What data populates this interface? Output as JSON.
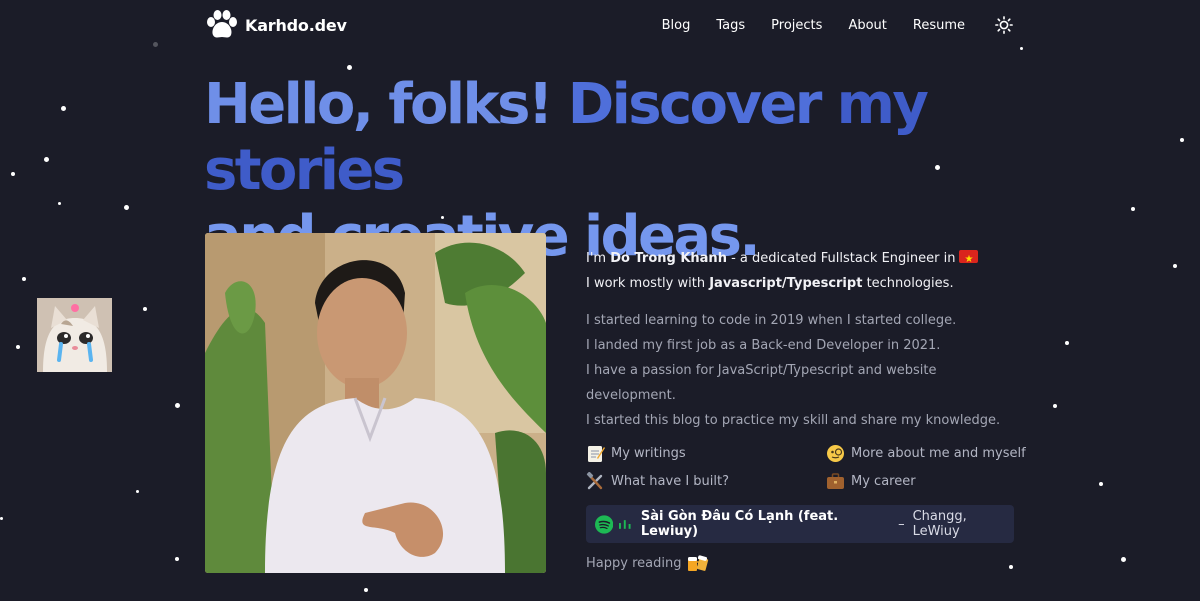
{
  "header": {
    "brand": "Karhdo.dev",
    "nav": [
      "Blog",
      "Tags",
      "Projects",
      "About",
      "Resume"
    ]
  },
  "hero": {
    "part1": "Hello, folks!",
    "part2": "Discover",
    "part3": "my stories",
    "part4": "and creative ideas."
  },
  "intro": {
    "lead": "I'm",
    "name": "Do Trong Khanh",
    "role": " - a dedicated Fullstack Engineer in",
    "line2_pre": "I work mostly with",
    "line2_tech": "Javascript/Typescript",
    "line2_post": "technologies."
  },
  "story": [
    "I started learning to code in 2019 when I started college.",
    "I landed my first job as a Back-end Developer in 2021.",
    "I have a passion for JavaScript/Typescript and website development.",
    "I started this blog to practice my skill and share my knowledge."
  ],
  "links": {
    "writings": "My writings",
    "about": "More about me and myself",
    "built": "What have I built?",
    "career": "My career"
  },
  "spotify": {
    "song": "Sài Gòn Đâu Có Lạnh (feat. Lewiuy)",
    "separator": "–",
    "artist": "Changg, LeWiuy"
  },
  "closing": "Happy reading",
  "colors": {
    "background": "#1b1c28",
    "hero_blue": "#4f6fda",
    "spotify_green": "#1db954",
    "spotify_card": "#262a42"
  }
}
